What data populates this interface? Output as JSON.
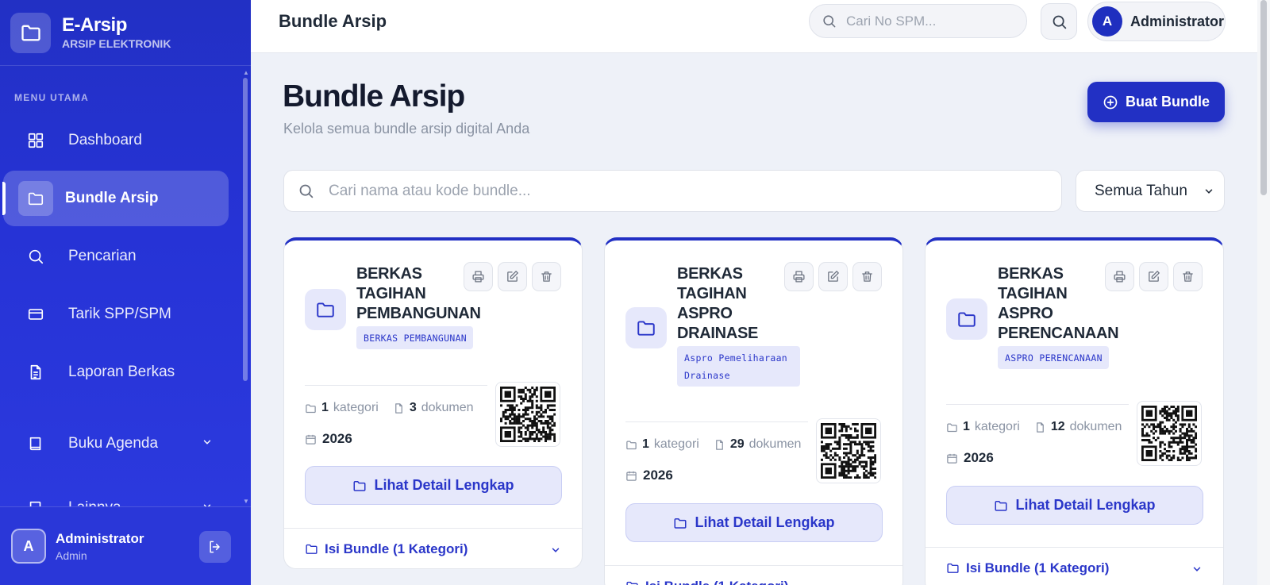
{
  "app": {
    "name": "E-Arsip",
    "subtitle": "ARSIP ELEKTRONIK"
  },
  "sidebar": {
    "heading": "MENU UTAMA",
    "items": [
      {
        "label": "Dashboard",
        "icon": "grid-icon"
      },
      {
        "label": "Bundle Arsip",
        "icon": "folder-icon",
        "active": true
      },
      {
        "label": "Pencarian",
        "icon": "search-icon"
      },
      {
        "label": "Tarik SPP/SPM",
        "icon": "credit-card-icon"
      },
      {
        "label": "Laporan Berkas",
        "icon": "document-icon"
      },
      {
        "label": "Buku Agenda",
        "icon": "book-icon",
        "expandable": true
      },
      {
        "label": "Lainnya",
        "icon": "book-icon",
        "expandable": true
      }
    ],
    "footer": {
      "avatar_initial": "A",
      "user_name": "Administrator",
      "user_role": "Admin"
    }
  },
  "topbar": {
    "title": "Bundle Arsip",
    "search_placeholder": "Cari No SPM...",
    "user_initial": "A",
    "user_name": "Administrator"
  },
  "main": {
    "heading": "Bundle Arsip",
    "subheading": "Kelola semua bundle arsip digital Anda",
    "create_button": "Buat Bundle",
    "search_placeholder": "Cari nama atau kode bundle...",
    "year_filter": "Semua Tahun"
  },
  "labels": {
    "kategori": "kategori",
    "dokumen": "dokumen",
    "detail_button": "Lihat Detail Lengkap",
    "footer_toggle": "Isi Bundle (1 Kategori)"
  },
  "cards": [
    {
      "title": "BERKAS TAGIHAN PEMBANGUNAN",
      "code": "BERKAS PEMBANGUNAN",
      "kategori_count": "1",
      "dokumen_count": "3",
      "year": "2026"
    },
    {
      "title": "BERKAS TAGIHAN ASPRO DRAINASE",
      "code": "Aspro Pemeliharaan Drainase",
      "kategori_count": "1",
      "dokumen_count": "29",
      "year": "2026"
    },
    {
      "title": "BERKAS TAGIHAN ASPRO PERENCANAAN",
      "code": "ASPRO PERENCANAAN",
      "kategori_count": "1",
      "dokumen_count": "12",
      "year": "2026"
    }
  ],
  "colors": {
    "primary": "#2230c4",
    "primary_light": "#e6e8fb",
    "background": "#eef1f8"
  }
}
